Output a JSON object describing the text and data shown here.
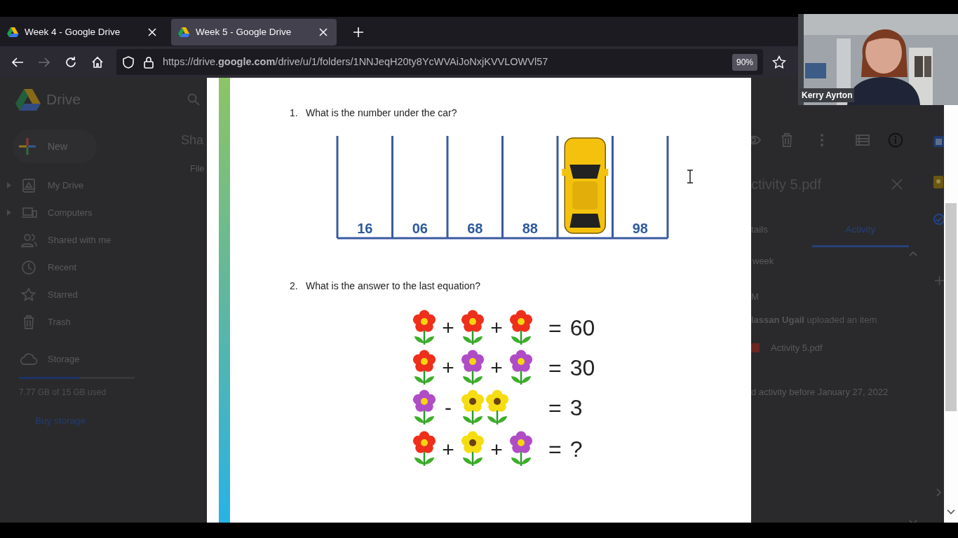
{
  "browser": {
    "tabs": [
      {
        "title": "Week 4 - Google Drive",
        "selected": false
      },
      {
        "title": "Week 5 - Google Drive",
        "selected": true
      }
    ],
    "forward": {
      "disabled": true
    },
    "url": "https://drive.**google.com**/drive/u/1/folders/1NNJeqH20ty8YcWVAiJoNxjKVVLOWVl57",
    "zoom": "90%"
  },
  "drive": {
    "app_name": "Drive",
    "new_button": "New",
    "nav": [
      {
        "label": "My Drive",
        "expandable": true
      },
      {
        "label": "Computers",
        "expandable": true
      },
      {
        "label": "Shared with me",
        "expandable": false
      },
      {
        "label": "Recent",
        "expandable": false
      },
      {
        "label": "Starred",
        "expandable": false
      },
      {
        "label": "Trash",
        "expandable": false
      }
    ],
    "storage": {
      "label": "Storage",
      "level": 0.52,
      "usage": "7.77 GB of 15 GB used"
    },
    "buy_storage": "Buy storage",
    "heading": "Sha",
    "files_label": "File"
  },
  "pdf": {
    "questions": [
      {
        "number": "1.",
        "text": "What is the number under the car?",
        "figure": {
          "kind": "parking",
          "slots": [
            {
              "kind": "number",
              "label": "16"
            },
            {
              "kind": "number",
              "label": "06"
            },
            {
              "kind": "number",
              "label": "68"
            },
            {
              "kind": "number",
              "label": "88"
            },
            {
              "kind": "car"
            },
            {
              "kind": "number",
              "label": "98"
            }
          ]
        }
      },
      {
        "number": "2.",
        "text": "What is the answer to the last equation?",
        "figure": {
          "kind": "flowers",
          "rows": [
            {
              "terms": [
                {
                  "kind": "flower",
                  "color": "#ee2f1c"
                },
                {
                  "kind": "op",
                  "text": "+"
                },
                {
                  "kind": "flower",
                  "color": "#ee2f1c"
                },
                {
                  "kind": "op",
                  "text": "+"
                },
                {
                  "kind": "flower",
                  "color": "#ee2f1c"
                }
              ],
              "equals": "=",
              "result": "60"
            },
            {
              "terms": [
                {
                  "kind": "flower",
                  "color": "#ee2f1c"
                },
                {
                  "kind": "op",
                  "text": "+"
                },
                {
                  "kind": "flower",
                  "color": "#b04cc6"
                },
                {
                  "kind": "op",
                  "text": "+"
                },
                {
                  "kind": "flower",
                  "color": "#b04cc6"
                }
              ],
              "equals": "=",
              "result": "30"
            },
            {
              "terms": [
                {
                  "kind": "flower",
                  "color": "#b04cc6"
                },
                {
                  "kind": "op",
                  "text": "-"
                },
                {
                  "kind": "daisy",
                  "color": "#f6dc12"
                },
                {
                  "kind": "daisy",
                  "color": "#f6dc12"
                }
              ],
              "equals": "=",
              "result": "3"
            },
            {
              "terms": [
                {
                  "kind": "flower",
                  "color": "#ee2f1c"
                },
                {
                  "kind": "op",
                  "text": "+"
                },
                {
                  "kind": "daisy",
                  "color": "#f6dc12"
                },
                {
                  "kind": "op",
                  "text": "+"
                },
                {
                  "kind": "flower",
                  "color": "#b04cc6"
                }
              ],
              "equals": "=",
              "result": "?"
            }
          ]
        }
      }
    ]
  },
  "details": {
    "title": "ctivity 5.pdf",
    "tabs": [
      {
        "label": "tails",
        "selected": false
      },
      {
        "label": "Activity",
        "selected": true
      }
    ],
    "period": "week",
    "time": "M",
    "entry": "**lassan Ugail** uploaded an item",
    "file": "Activity 5.pdf",
    "footer": "d activity before January 27, 2022"
  },
  "video": {
    "name": "Kerry Ayrton"
  }
}
